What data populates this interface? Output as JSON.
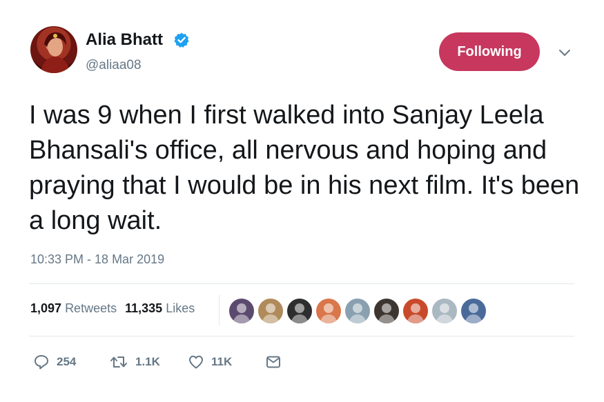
{
  "user": {
    "name": "Alia Bhatt",
    "handle": "@aliaa08",
    "verified": true
  },
  "follow_button": {
    "label": "Following",
    "color": "#c7375e"
  },
  "tweet": {
    "text": "I was 9 when I first walked into Sanjay Leela Bhansali's office, all nervous and hoping and praying that I would be in his next film. It's been a long wait.",
    "timestamp": "10:33 PM - 18 Mar 2019"
  },
  "stats": {
    "retweets_count": "1,097",
    "retweets_label": "Retweets",
    "likes_count": "11,335",
    "likes_label": "Likes"
  },
  "liker_avatars": [
    {
      "name": "liker-avatar-1",
      "color": "#5b4a6e"
    },
    {
      "name": "liker-avatar-2",
      "color": "#b08a5a"
    },
    {
      "name": "liker-avatar-3",
      "color": "#2e2e2e"
    },
    {
      "name": "liker-avatar-4",
      "color": "#d9764a"
    },
    {
      "name": "liker-avatar-5",
      "color": "#8aa0b0"
    },
    {
      "name": "liker-avatar-6",
      "color": "#3d3530"
    },
    {
      "name": "liker-avatar-7",
      "color": "#c94a2a"
    },
    {
      "name": "liker-avatar-8",
      "color": "#aab8c2"
    },
    {
      "name": "liker-avatar-9",
      "color": "#4a6a9a"
    }
  ],
  "actions": {
    "reply_count": "254",
    "retweet_count": "1.1K",
    "like_count": "11K",
    "icons": [
      "reply-icon",
      "retweet-icon",
      "like-icon",
      "direct-message-icon"
    ]
  },
  "colors": {
    "accent": "#1da1f2",
    "secondary_text": "#657786",
    "divider": "#e1e8ed"
  }
}
